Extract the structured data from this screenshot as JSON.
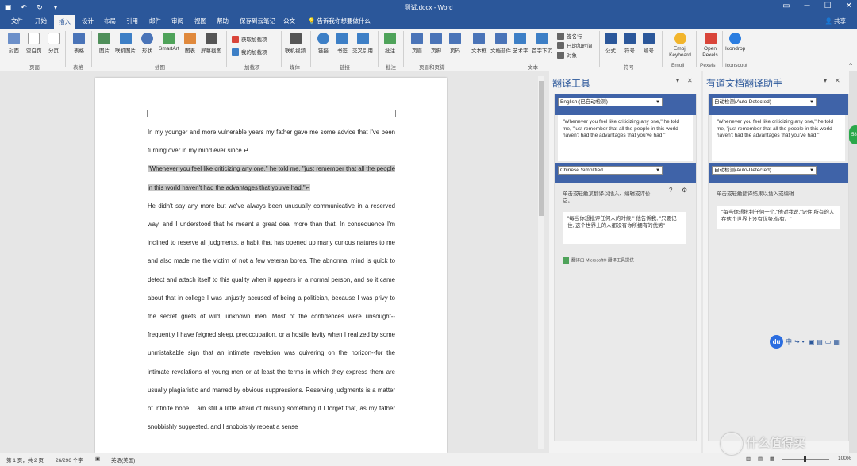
{
  "window": {
    "title": "测试.docx - Word",
    "quick_access": [
      "save-icon",
      "undo-icon",
      "redo-icon",
      "customize-icon"
    ]
  },
  "tabs": [
    "文件",
    "开始",
    "插入",
    "设计",
    "布局",
    "引用",
    "邮件",
    "审阅",
    "视图",
    "帮助",
    "保存到云笔记",
    "公文"
  ],
  "active_tab": "插入",
  "tell_me": "告诉我你想要做什么",
  "share_label": "共享",
  "ribbon": {
    "buttons": [
      {
        "label": "封面",
        "icon": "cover-page-icon",
        "color": "#6b8fc9"
      },
      {
        "label": "空白页",
        "icon": "blank-page-icon",
        "color": "#ffffff"
      },
      {
        "label": "分页",
        "icon": "page-break-icon",
        "color": "#ffffff"
      },
      {
        "label": "表格",
        "icon": "table-icon",
        "color": "#4a74b8"
      },
      {
        "label": "图片",
        "icon": "picture-icon",
        "color": "#4f8f5a"
      },
      {
        "label": "联机图片",
        "icon": "online-picture-icon",
        "color": "#3d7fc6"
      },
      {
        "label": "形状",
        "icon": "shapes-icon",
        "color": "#4a74b8"
      },
      {
        "label": "SmartArt",
        "icon": "smartart-icon",
        "color": "#4fa35a"
      },
      {
        "label": "图表",
        "icon": "chart-icon",
        "color": "#e0893c"
      },
      {
        "label": "屏幕截图",
        "icon": "screenshot-icon",
        "color": "#555555"
      },
      {
        "label": "联机视频",
        "icon": "online-video-icon",
        "color": "#555555"
      },
      {
        "label": "链接",
        "icon": "link-icon",
        "color": "#3d7fc6"
      },
      {
        "label": "书签",
        "icon": "bookmark-icon",
        "color": "#3d7fc6"
      },
      {
        "label": "交叉引用",
        "icon": "cross-reference-icon",
        "color": "#3d7fc6"
      },
      {
        "label": "批注",
        "icon": "comment-icon",
        "color": "#4fa35a"
      },
      {
        "label": "页眉",
        "icon": "header-icon",
        "color": "#4a74b8"
      },
      {
        "label": "页脚",
        "icon": "footer-icon",
        "color": "#4a74b8"
      },
      {
        "label": "页码",
        "icon": "page-number-icon",
        "color": "#4a74b8"
      },
      {
        "label": "文本框",
        "icon": "text-box-icon",
        "color": "#4a74b8"
      },
      {
        "label": "文档部件",
        "icon": "quick-parts-icon",
        "color": "#4a74b8"
      },
      {
        "label": "艺术字",
        "icon": "wordart-icon",
        "color": "#3d7fc6"
      },
      {
        "label": "首字下沉",
        "icon": "drop-cap-icon",
        "color": "#3d7fc6"
      },
      {
        "label": "公式",
        "icon": "equation-icon",
        "color": "#2b579a"
      },
      {
        "label": "符号",
        "icon": "symbol-icon",
        "color": "#2b579a"
      },
      {
        "label": "编号",
        "icon": "number-icon",
        "color": "#2b579a"
      },
      {
        "label": "Emoji Keyboard",
        "icon": "emoji-icon",
        "color": "#f2b52c"
      },
      {
        "label": "Open Pexels",
        "icon": "pexels-icon",
        "color": "#d9453a"
      },
      {
        "label": "Icondrop",
        "icon": "icondrop-icon",
        "color": "#2b7de0"
      }
    ],
    "small_buttons": [
      {
        "label": "获取加载项",
        "icon": "store-icon"
      },
      {
        "label": "我的加载项",
        "icon": "my-addins-icon"
      },
      {
        "label": "签名行",
        "icon": "signature-line-icon"
      },
      {
        "label": "日期和时间",
        "icon": "date-time-icon"
      },
      {
        "label": "对象",
        "icon": "object-icon"
      }
    ],
    "groups": [
      "页面",
      "表格",
      "插图",
      "加载项",
      "媒体",
      "链接",
      "批注",
      "页眉和页脚",
      "文本",
      "符号",
      "Emoji",
      "Pexels",
      "Iconscout"
    ]
  },
  "document": {
    "paragraphs": [
      "In my younger and more vulnerable years my father gave me some advice that I've been turning over in my mind ever since.↵",
      "\"Whenever you feel like criticizing any one,\" he told me, \"just remember that all the people in this world haven't had the advantages that you've had.\"↵",
      "He didn't say any more but we've always been unusually communicative in a reserved way, and I understood that he meant a great deal more than that. In consequence I'm inclined to reserve all judgments, a habit that has opened up many curious natures to me and also made me the victim of not a few veteran bores. The abnormal mind is quick to detect and attach itself to this quality when it appears in a normal person, and so it came about that in college I was unjustly accused of being a politician, because I was privy to the secret griefs of wild, unknown men. Most of the confidences were unsought--frequently I have feigned sleep, preoccupation, or a hostile levity when I realized by some unmistakable sign that an intimate revelation was quivering on the horizon--for the intimate revelations of young men or at least the terms in which they express them are usually plagiaristic and marred by obvious suppressions. Reserving judgments is a matter of infinite hope. I am still a little afraid of missing something if I forget that, as my father snobbishly suggested, and I snobbishly repeat a sense"
    ]
  },
  "translator_pane": {
    "title": "翻译工具",
    "source_lang": "English (已自动检测)",
    "source_text": "\"Whenever you feel like criticizing any one,\" he told me, \"just remember that all the people in this world haven't had the advantages that you've had.\"",
    "target_lang": "Chinese Simplified",
    "hint": "单击或轻触某翻译以插入、编辑或评价它。",
    "result": "\"每当你想批评任何人的时候,\" 他告诉我, \"只要记住, 这个世界上的人都没有你所拥有的优势\"",
    "footer": "翻译由 Microsoft® 翻译工具提供"
  },
  "youdao_pane": {
    "title": "有道文档翻译助手",
    "source_lang": "自动检测(Auto-Detected)",
    "source_text": "\"Whenever you feel like criticizing any one,\" he told me, \"just remember that all the people in this world haven't had the advantages that you've had.\"",
    "target_lang": "自动检测(Auto-Detected)",
    "hint": "单击或轻触翻译结果以插入或编辑",
    "result": "\"每当你想批判任何一个,\"他对我说,\"记住,所有的人在这个世界上没有优势,你有。\""
  },
  "du_toolbar": {
    "logo": "du",
    "lang": "中"
  },
  "statusbar": {
    "page": "第 1 页，共 2 页",
    "words": "26/296 个字",
    "lang": "英语(美国)",
    "zoom": "100%"
  },
  "watermark": "什么值得买",
  "colors": {
    "brand": "#2b579a",
    "pane_bar": "#3f63a8"
  }
}
